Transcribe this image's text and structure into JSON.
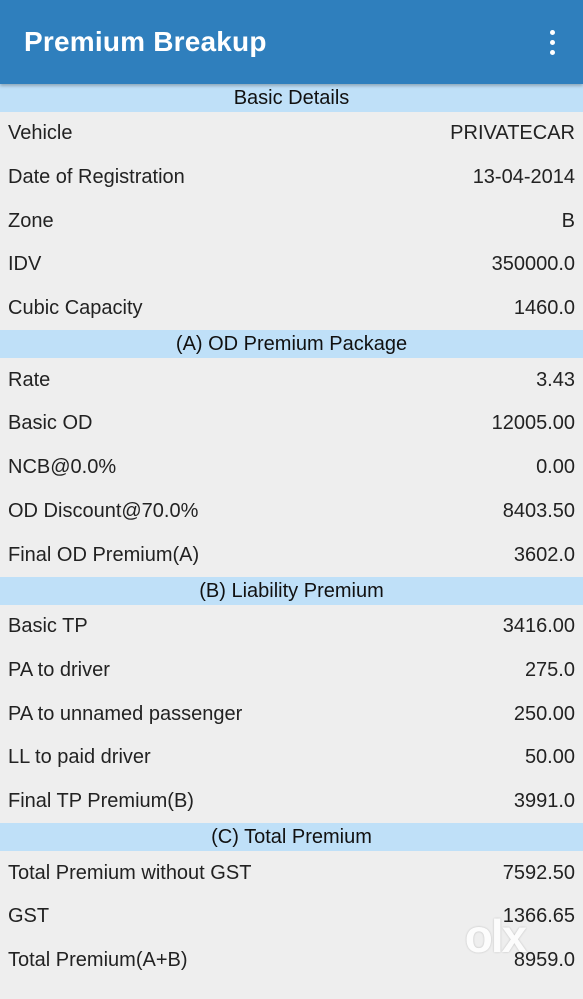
{
  "appbar": {
    "title": "Premium Breakup",
    "menu_icon": "more-vert-icon"
  },
  "sections": {
    "basic": {
      "title": "Basic Details",
      "rows": [
        {
          "label": "Vehicle",
          "value": "PRIVATECAR"
        },
        {
          "label": "Date of Registration",
          "value": "13-04-2014"
        },
        {
          "label": "Zone",
          "value": "B"
        },
        {
          "label": "IDV",
          "value": "350000.0"
        },
        {
          "label": "Cubic Capacity",
          "value": "1460.0"
        }
      ]
    },
    "od": {
      "title": "(A) OD Premium Package",
      "rows": [
        {
          "label": "Rate",
          "value": "3.43"
        },
        {
          "label": "Basic OD",
          "value": "12005.00"
        },
        {
          "label": "NCB@0.0%",
          "value": "0.00"
        },
        {
          "label": "OD Discount@70.0%",
          "value": "8403.50"
        },
        {
          "label": "Final OD Premium(A)",
          "value": "3602.0"
        }
      ]
    },
    "liability": {
      "title": "(B) Liability Premium",
      "rows": [
        {
          "label": "Basic TP",
          "value": "3416.00"
        },
        {
          "label": "PA to driver",
          "value": "275.0"
        },
        {
          "label": "PA to unnamed passenger",
          "value": "250.00"
        },
        {
          "label": "LL to paid driver",
          "value": "50.00"
        },
        {
          "label": "Final TP Premium(B)",
          "value": "3991.0"
        }
      ]
    },
    "total": {
      "title": "(C) Total Premium",
      "rows": [
        {
          "label": "Total Premium without GST",
          "value": "7592.50"
        },
        {
          "label": "GST",
          "value": "1366.65"
        },
        {
          "label": "Total Premium(A+B)",
          "value": "8959.0"
        }
      ]
    }
  },
  "watermark": {
    "text": "olx"
  },
  "colors": {
    "appbar": "#2f7fbd",
    "section_header": "#bfe0f8",
    "background": "#eeeeee"
  }
}
